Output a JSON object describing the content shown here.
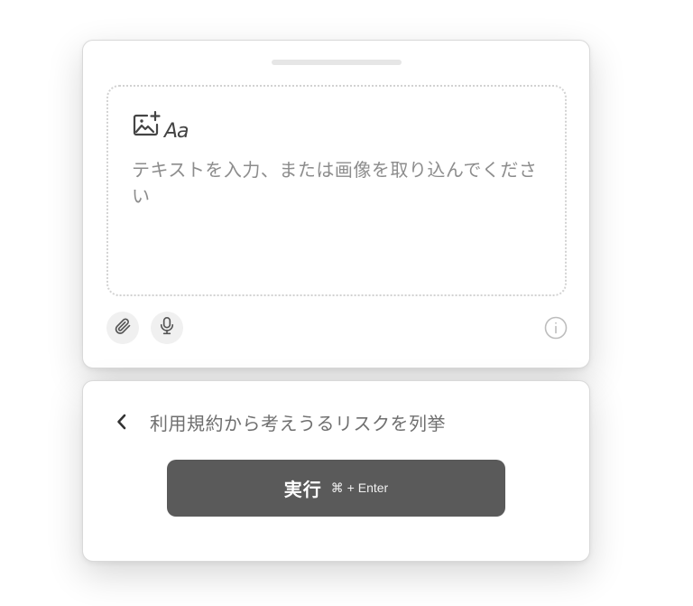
{
  "editor": {
    "placeholder": "テキストを入力、または画像を取り込んでください",
    "input_type_icons": [
      "image-add-icon",
      "text-aa-icon"
    ],
    "aa_glyph": "Aa",
    "toolbar": {
      "attach_icon": "paperclip-icon",
      "mic_icon": "microphone-icon",
      "info_icon": "info-icon"
    }
  },
  "action_panel": {
    "back_icon": "chevron-left-icon",
    "prompt_title": "利用規約から考えうるリスクを列挙",
    "run_button": {
      "label": "実行",
      "shortcut": "⌘ + Enter"
    }
  },
  "colors": {
    "run_button_bg": "#5a5a5a",
    "placeholder_text": "#8c8c8c",
    "card_border": "#d9d9d9",
    "dropzone_border": "#d2d2d2"
  }
}
